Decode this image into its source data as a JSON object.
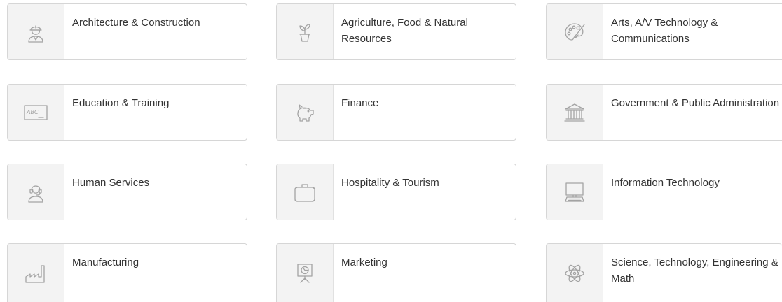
{
  "clusters": [
    {
      "label": "Architecture & Construction",
      "icon": "construction-worker-icon"
    },
    {
      "label": "Agriculture, Food & Natural Resources",
      "icon": "plant-pot-icon"
    },
    {
      "label": "Arts, A/V Technology & Communications",
      "icon": "paint-palette-icon"
    },
    {
      "label": "Education & Training",
      "icon": "chalkboard-icon",
      "icon_text": "ABC"
    },
    {
      "label": "Finance",
      "icon": "piggy-bank-icon"
    },
    {
      "label": "Government & Public Administration",
      "icon": "government-building-icon"
    },
    {
      "label": "Human Services",
      "icon": "headset-person-icon"
    },
    {
      "label": "Hospitality & Tourism",
      "icon": "suitcase-icon"
    },
    {
      "label": "Information Technology",
      "icon": "computer-icon"
    },
    {
      "label": "Manufacturing",
      "icon": "factory-icon"
    },
    {
      "label": "Marketing",
      "icon": "presentation-chart-icon"
    },
    {
      "label": "Science, Technology, Engineering & Math",
      "icon": "atom-icon"
    }
  ],
  "colors": {
    "card_border": "#d6d6d6",
    "icon_cell_bg": "#f3f3f3",
    "icon_stroke": "#a3a3a3",
    "label_text": "#333333"
  }
}
